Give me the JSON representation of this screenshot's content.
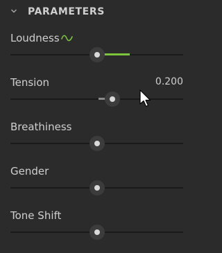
{
  "section": {
    "title": "PARAMETERS",
    "collapse_icon": "chevron-down-icon"
  },
  "colors": {
    "accent": "#7cc43c",
    "neutral_fill": "#8a8a8a",
    "track": "#1a1a1a",
    "background": "#2b2b2b"
  },
  "params": [
    {
      "label": "Loudness",
      "icon": "waveform-icon",
      "value_text": "",
      "level": 0.5,
      "range": [
        0.5,
        0.69
      ],
      "fill": "accent"
    },
    {
      "label": "Tension",
      "icon": "",
      "value_text": "0.200",
      "level": 0.59,
      "range": [
        0.51,
        0.59
      ],
      "fill": "neutral"
    },
    {
      "label": "Breathiness",
      "icon": "",
      "value_text": "",
      "level": 0.5,
      "range": null,
      "fill": "none"
    },
    {
      "label": "Gender",
      "icon": "",
      "value_text": "",
      "level": 0.5,
      "range": null,
      "fill": "none"
    },
    {
      "label": "Tone Shift",
      "icon": "",
      "value_text": "",
      "level": 0.5,
      "range": null,
      "fill": "none"
    }
  ]
}
